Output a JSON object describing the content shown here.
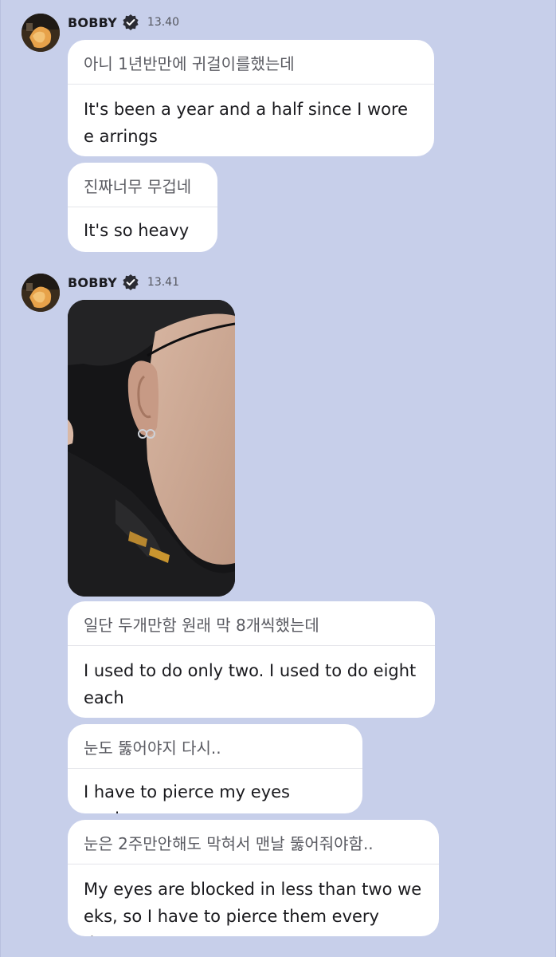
{
  "group1": {
    "sender": "BOBBY",
    "time": "13.40",
    "messages": [
      {
        "original": "아니 1년반만에 귀걸이를했는데",
        "translation": "It's been a year and a half since I wore e arrings"
      },
      {
        "original": "진짜너무 무겁네",
        "translation": "It's so heavy"
      }
    ]
  },
  "group2": {
    "sender": "BOBBY",
    "time": "13.41",
    "messages": [
      {
        "original": "일단 두개만함 원래 막 8개씩했는데",
        "translation": "I used to do only two. I used to do eight each"
      },
      {
        "original": "눈도 뚫어야지 다시..",
        "translation": "I have to pierce my eyes again.."
      },
      {
        "original": "눈은 2주만안해도 막혀서 맨날 뚫어줘야함..",
        "translation": "My eyes are blocked in less than two we eks, so I have to pierce them every day.."
      }
    ]
  },
  "colors": {
    "background": "#c7cfea",
    "bubble": "#ffffff"
  },
  "icons": {
    "verified": "verified-badge-icon"
  }
}
